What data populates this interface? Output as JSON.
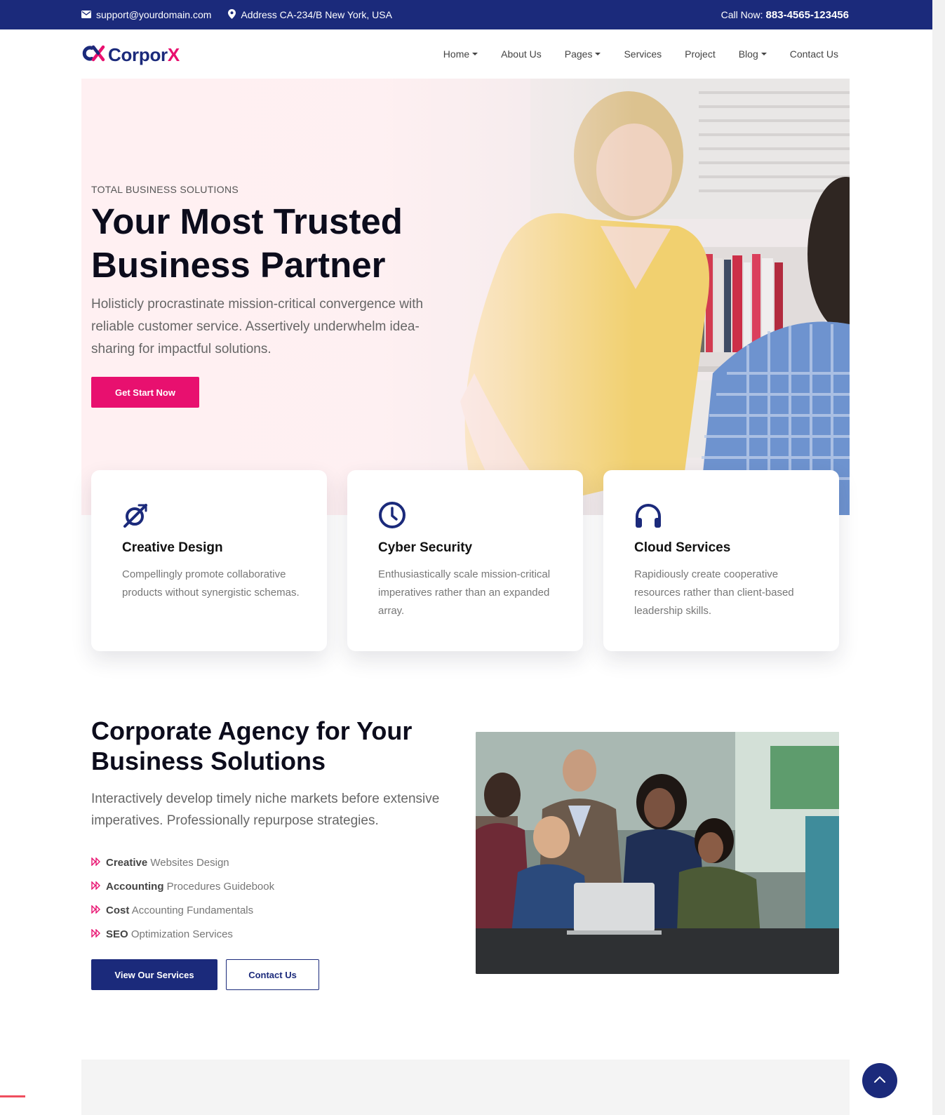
{
  "topbar": {
    "email": "support@yourdomain.com",
    "address": "Address CA-234/B New York, USA",
    "call_label": "Call Now:",
    "phone": "883-4565-123456",
    "bg_color": "#1b2a7b"
  },
  "brand": {
    "name_main": "Corpor",
    "name_accent": "X",
    "primary_color": "#1b2a7b",
    "accent_color": "#e8106f"
  },
  "nav": {
    "items": [
      {
        "label": "Home",
        "dropdown": true
      },
      {
        "label": "About Us",
        "dropdown": false
      },
      {
        "label": "Pages",
        "dropdown": true
      },
      {
        "label": "Services",
        "dropdown": false
      },
      {
        "label": "Project",
        "dropdown": false
      },
      {
        "label": "Blog",
        "dropdown": true
      },
      {
        "label": "Contact Us",
        "dropdown": false
      }
    ]
  },
  "hero": {
    "eyebrow": "TOTAL BUSINESS SOLUTIONS",
    "title_line1": "Your Most Trusted",
    "title_line2": "Business Partner",
    "text": "Holisticly procrastinate mission-critical convergence with reliable customer service. Assertively underwhelm idea-sharing for impactful solutions.",
    "cta": "Get Start Now"
  },
  "features": [
    {
      "icon": "orbit-icon",
      "title": "Creative Design",
      "desc": "Compellingly promote collaborative products without synergistic schemas."
    },
    {
      "icon": "clock-icon",
      "title": "Cyber Security",
      "desc": "Enthusiastically scale mission-critical imperatives rather than an expanded array."
    },
    {
      "icon": "headphones-icon",
      "title": "Cloud Services",
      "desc": "Rapidiously create cooperative resources rather than client-based leadership skills."
    }
  ],
  "agency": {
    "title": "Corporate Agency for Your Business Solutions",
    "text": "Interactively develop timely niche markets before extensive imperatives. Professionally repurpose strategies.",
    "list": [
      {
        "bold": "Creative",
        "rest": "Websites Design"
      },
      {
        "bold": "Accounting",
        "rest": "Procedures Guidebook"
      },
      {
        "bold": "Cost",
        "rest": "Accounting Fundamentals"
      },
      {
        "bold": "SEO",
        "rest": "Optimization Services"
      }
    ],
    "primary_button": "View Our Services",
    "secondary_button": "Contact Us"
  },
  "scroll_top_icon": "chevron-up-icon"
}
